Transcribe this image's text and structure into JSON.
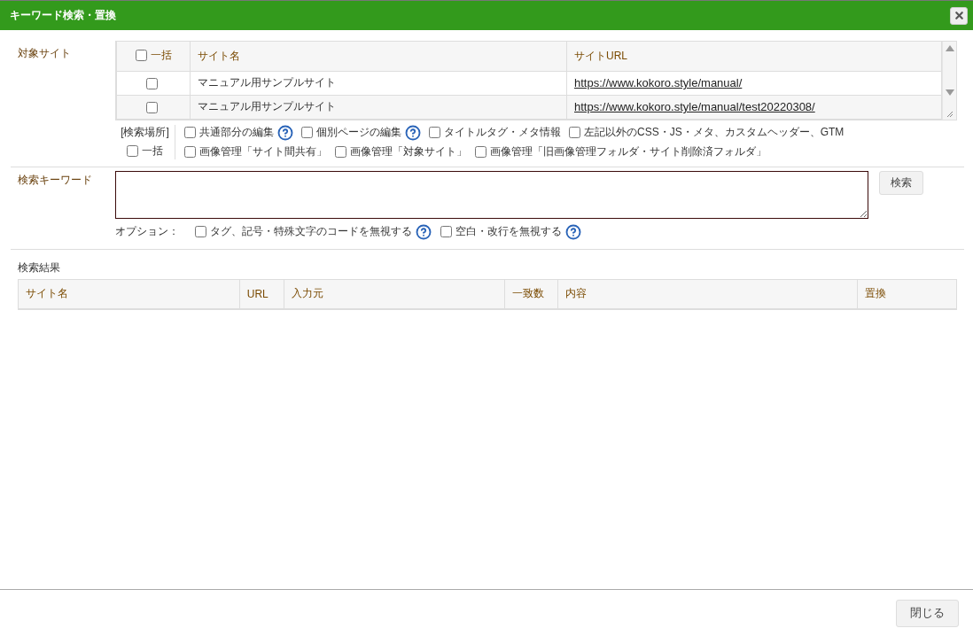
{
  "dialog": {
    "title": "キーワード検索・置換",
    "close_button": "閉じる"
  },
  "target_sites": {
    "label": "対象サイト",
    "select_all": {
      "label": "一括",
      "checked": false
    },
    "columns": [
      "サイト名",
      "サイトURL"
    ],
    "rows": [
      {
        "checked": false,
        "name": "マニュアル用サンプルサイト",
        "url": "https://www.kokoro.style/manual/"
      },
      {
        "checked": false,
        "name": "マニュアル用サンプルサイト",
        "url": "https://www.kokoro.style/manual/test20220308/"
      }
    ]
  },
  "search_locations": {
    "label": "[検索場所]",
    "select_all": {
      "label": "一括",
      "checked": false
    },
    "lines": [
      [
        {
          "label": "共通部分の編集",
          "checked": false,
          "help": true
        },
        {
          "label": "個別ページの編集",
          "checked": false,
          "help": true
        },
        {
          "label": "タイトルタグ・メタ情報",
          "checked": false,
          "help": false
        },
        {
          "label": "左記以外のCSS・JS・メタ、カスタムヘッダー、GTM",
          "checked": false,
          "help": false
        }
      ],
      [
        {
          "label": "画像管理「サイト間共有」",
          "checked": false,
          "help": false
        },
        {
          "label": "画像管理「対象サイト」",
          "checked": false,
          "help": false
        },
        {
          "label": "画像管理「旧画像管理フォルダ・サイト削除済フォルダ」",
          "checked": false,
          "help": false
        }
      ]
    ]
  },
  "keyword": {
    "label": "検索キーワード",
    "search_button": "検索",
    "options_label": "オプション：",
    "options": [
      {
        "label": "タグ、記号・特殊文字のコードを無視する",
        "checked": false,
        "help": true
      },
      {
        "label": "空白・改行を無視する",
        "checked": false,
        "help": true
      }
    ]
  },
  "results": {
    "label": "検索結果",
    "columns": [
      "サイト名",
      "URL",
      "入力元",
      "一致数",
      "内容",
      "置換"
    ]
  }
}
